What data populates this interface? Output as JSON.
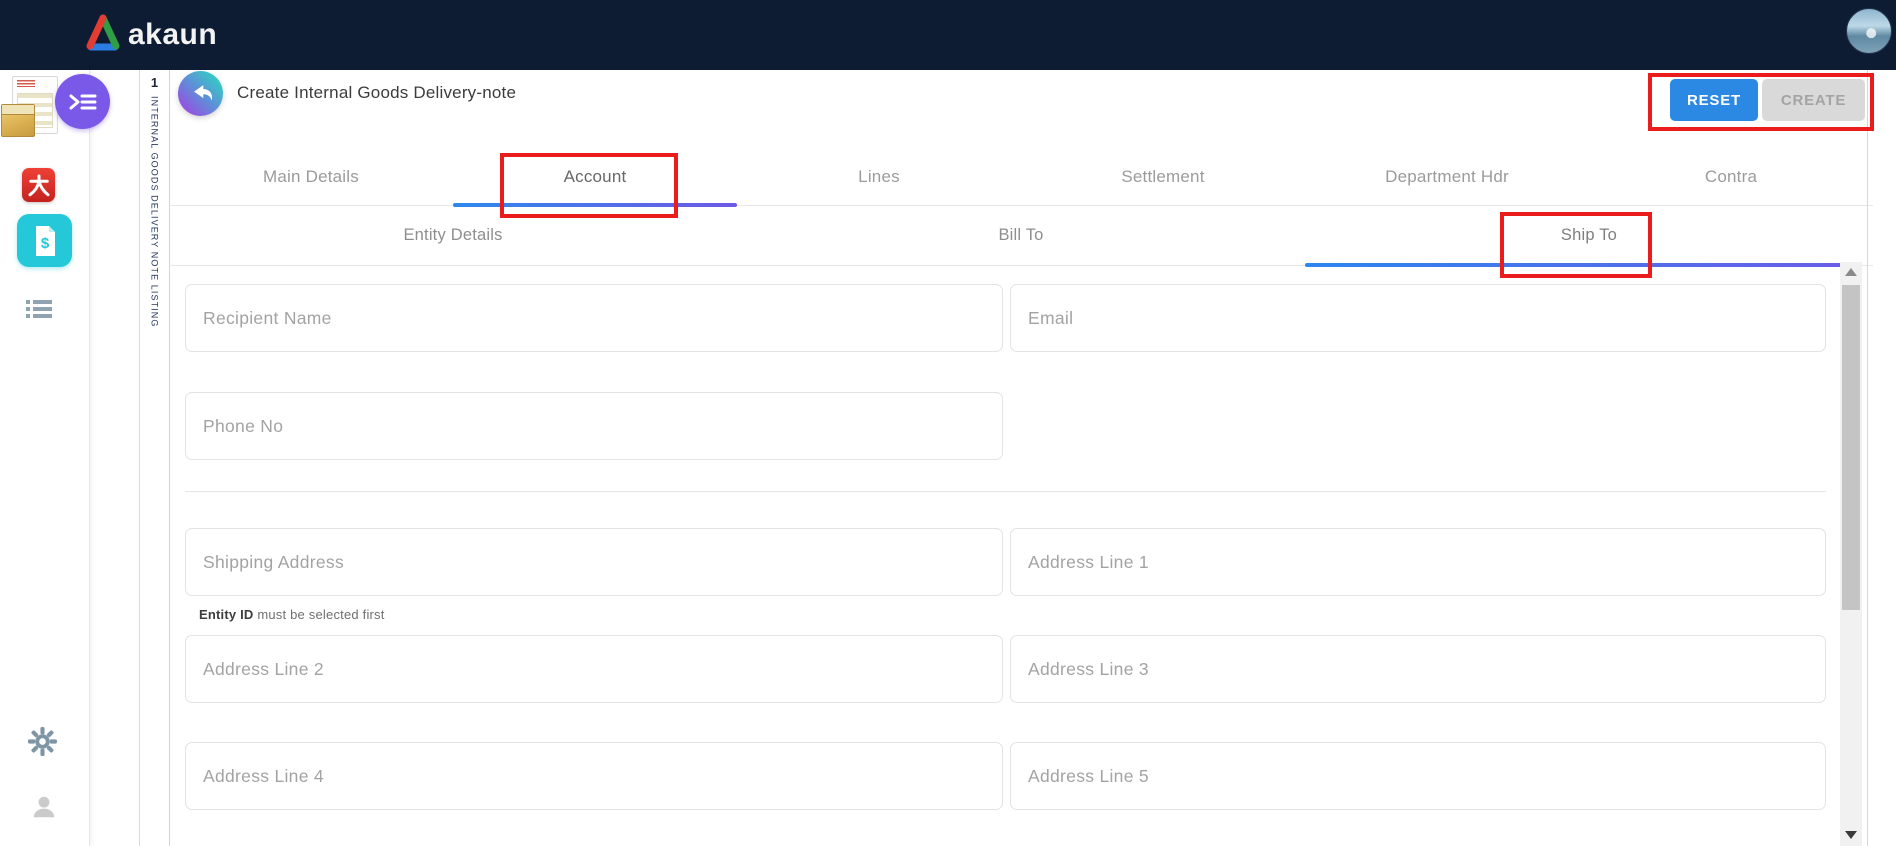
{
  "topbar": {
    "brand": "akaun"
  },
  "sidebar": {
    "listing_index": "1",
    "listing_label": "INTERNAL GOODS DELIVERY NOTE LISTING",
    "icons": {
      "delivery_note_app": "delivery-note-app-icon",
      "launcher": "prompt-menu-icon",
      "red_app": "dai-red-app-icon",
      "teal_app": "billing-document-app-icon",
      "list": "listing-icon",
      "gear": "settings-gear-icon",
      "user": "user-profile-icon"
    }
  },
  "header": {
    "title": "Create Internal Goods Delivery-note",
    "reset_label": "RESET",
    "create_label": "CREATE"
  },
  "tabs": {
    "items": [
      "Main Details",
      "Account",
      "Lines",
      "Settlement",
      "Department Hdr",
      "Contra"
    ],
    "active": "Account"
  },
  "subtabs": {
    "items": [
      "Entity Details",
      "Bill To",
      "Ship To"
    ],
    "active": "Ship To"
  },
  "form": {
    "placeholders": {
      "recipient_name": "Recipient Name",
      "email": "Email",
      "phone_no": "Phone No",
      "shipping_address": "Shipping Address",
      "address_line_1": "Address Line 1",
      "address_line_2": "Address Line 2",
      "address_line_3": "Address Line 3",
      "address_line_4": "Address Line 4",
      "address_line_5": "Address Line 5"
    },
    "helper": {
      "bold": "Entity ID",
      "rest": " must be selected first"
    }
  },
  "colors": {
    "topbar_bg": "#0e1c33",
    "primary_blue": "#2b89e4",
    "tab_gradient_start": "#2d89ec",
    "tab_gradient_end": "#6e59e6",
    "annotation_red": "#ea1c1c",
    "teal_app": "#25c8d9",
    "launcher_purple": "#7a58e8",
    "red_app": "#d42e28"
  }
}
